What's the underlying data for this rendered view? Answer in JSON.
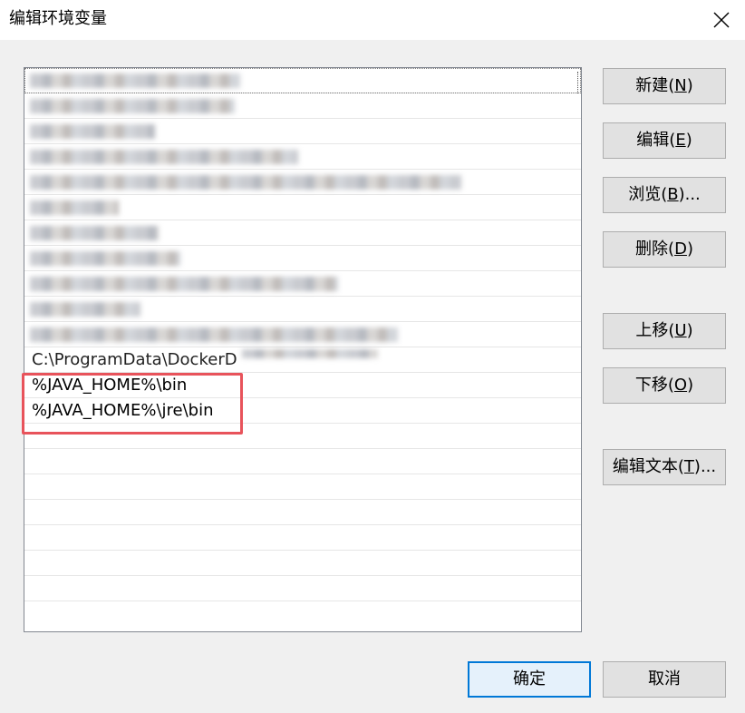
{
  "window": {
    "title": "编辑环境变量"
  },
  "paths": {
    "visible_partial": "C:\\ProgramData\\DockerD",
    "java_bin": "%JAVA_HOME%\\bin",
    "java_jre_bin": "%JAVA_HOME%\\jre\\bin"
  },
  "buttons": {
    "new": {
      "text": "新建(",
      "key": "N",
      "suffix": ")"
    },
    "edit": {
      "text": "编辑(",
      "key": "E",
      "suffix": ")"
    },
    "browse": {
      "text": "浏览(",
      "key": "B",
      "suffix": ")..."
    },
    "delete": {
      "text": "删除(",
      "key": "D",
      "suffix": ")"
    },
    "move_up": {
      "text": "上移(",
      "key": "U",
      "suffix": ")"
    },
    "move_down": {
      "text": "下移(",
      "key": "O",
      "suffix": ")"
    },
    "edit_text": {
      "text": "编辑文本(",
      "key": "T",
      "suffix": ")..."
    },
    "ok": "确定",
    "cancel": "取消"
  },
  "colors": {
    "highlight": "#e8535b",
    "accent": "#0078d7"
  }
}
